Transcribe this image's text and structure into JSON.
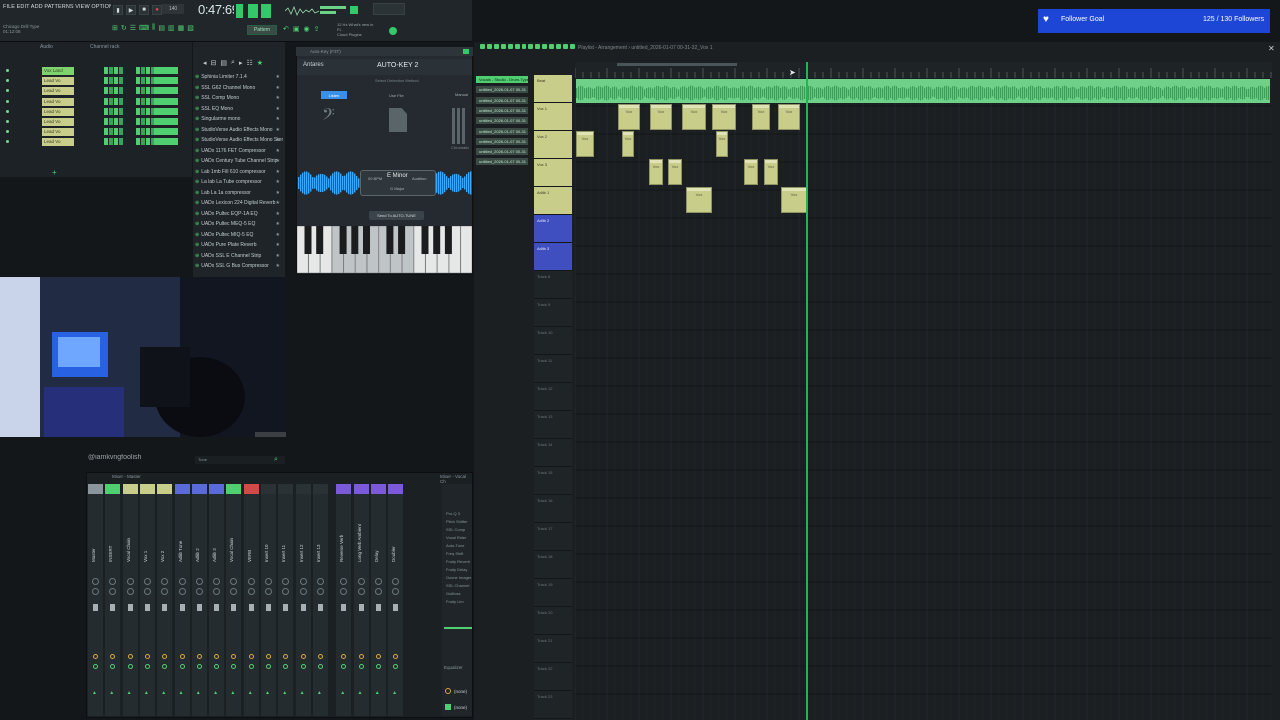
{
  "menu": {
    "items_text": "FILE EDIT ADD PATTERNS VIEW OPTIONS TOOLS HELP"
  },
  "song": {
    "line1": "Chicago Drill Type",
    "line2": "01:12:08"
  },
  "transport": {
    "tempo": "140",
    "time": "0:47:69",
    "pattern_button": "Pattern"
  },
  "cpu": {
    "line1": "12 Hz  What's new in FL",
    "line2": "Cloud Plugins"
  },
  "rack": {
    "header_left": "Audio",
    "header_right": "Channel rack",
    "rows": [
      {
        "name": "Vox Land"
      },
      {
        "name": "Lead Vo"
      },
      {
        "name": "Lead Vo"
      },
      {
        "name": "Lead Vo"
      },
      {
        "name": "Lead Vo"
      },
      {
        "name": "Lead Vo"
      },
      {
        "name": "Lead Vo"
      },
      {
        "name": "Lead Vo"
      }
    ]
  },
  "browser": {
    "items": [
      "Sphinia Limiter 7.1.4",
      "SSL G62 Channel Mono",
      "SSL Comp Mono",
      "SSL EQ Mono",
      "Singularme mono",
      "StudioVerse Audio Effects Mono",
      "StudioVerse Audio Effects Mono Stereo",
      "UADx 1176 FET Compressor",
      "UADx Century Tube Channel Strip",
      "Lab 1mb Fill 610 compressor",
      "La lab La Tube compressor",
      "Lab La 1a compressor",
      "UADx Lexicon 224 Digital Reverb",
      "UADx Pultec EQP-1A EQ",
      "UADx Pultec MEQ-5 EQ",
      "UADx Pultec MIQ-5 EQ",
      "UADx Pure Plate Reverb",
      "UADx SSL E Channel Strip",
      "UADx SSL G Bus Compressor"
    ]
  },
  "plugin": {
    "title": "Auto-Key (F3T)",
    "brand": "Antares",
    "logo": "AUTO-KEY 2",
    "subtitle": "Select Detection Method",
    "listen": "Listen",
    "file": "Use File",
    "manual": "Manual",
    "chromatic": "Chromatic",
    "detected_key": "E Minor",
    "tempo_small": "00 BPM",
    "alt": "Audition",
    "scale_small": "G Major",
    "send": "Send To AUTO-TUNE"
  },
  "stream": {
    "handle": "@iamkvngfoolish",
    "input_value": "Tune"
  },
  "mixer": {
    "header_left": "Mixer - Master",
    "header_right": "Mixer - Vocal Ch",
    "tracks": [
      {
        "name": "Master",
        "color": "#8a969b"
      },
      {
        "name": "INSERT",
        "color": "#4fcf70"
      },
      {
        "name": "Vocal Chain",
        "color": "#c8ce8a"
      },
      {
        "name": "Vox 1",
        "color": "#c8ce8a"
      },
      {
        "name": "Vox 2",
        "color": "#c8ce8a"
      },
      {
        "name": "Adlib Tune",
        "color": "#5a6ad8"
      },
      {
        "name": "Adlib 2",
        "color": "#5a6ad8"
      },
      {
        "name": "Adlib 3",
        "color": "#5a6ad8"
      },
      {
        "name": "Vocal Chain",
        "color": "#4fcf70"
      },
      {
        "name": "VERB",
        "color": "#d04a4a"
      },
      {
        "name": "Insert 10",
        "color": "#2b3236"
      },
      {
        "name": "Insert 11",
        "color": "#2b3236"
      },
      {
        "name": "Insert 12",
        "color": "#2b3236"
      },
      {
        "name": "Insert 13",
        "color": "#2b3236"
      },
      {
        "name": "Reverse Verb",
        "color": "#7a5ad8"
      },
      {
        "name": "Long Verb Ambient",
        "color": "#7a5ad8"
      },
      {
        "name": "Delay",
        "color": "#7a5ad8"
      },
      {
        "name": "Doubler",
        "color": "#7a5ad8"
      }
    ],
    "inserts": [
      "Pro-Q 3",
      "Pitch Shifter",
      "SSL Comp",
      "Vocal Rider",
      "Auto-Tune",
      "Freq Shift",
      "Fruity Reverb",
      "Fruity Delay",
      "Ozone Imager",
      "SSL Channel",
      "Gullfoss",
      "Fruity Lim"
    ],
    "eq_label": "Equalizer",
    "none1": "(none)",
    "none2": "(none)"
  },
  "playlist": {
    "title": "Playlist - Arrangement › untitled_2026-01-07 00-31-32_Vox 1",
    "patterns": [
      "Vocals - Studio - Drum-Type-Beat",
      "untitled_2026-01-07 00-31",
      "untitled_2026-01-07 00-31",
      "untitled_2026-01-07 00-31",
      "untitled_2026-01-07 00-31",
      "untitled_2026-01-07 00-31",
      "untitled_2026-01-07 00-31",
      "untitled_2026-01-07 00-31",
      "untitled_2026-01-07 00-31"
    ],
    "tracks": [
      {
        "name": "Beat",
        "kind": "y"
      },
      {
        "name": "Vox 1",
        "kind": "y"
      },
      {
        "name": "Vox 2",
        "kind": "y"
      },
      {
        "name": "Vox 3",
        "kind": "y"
      },
      {
        "name": "Adlib 1",
        "kind": "y"
      },
      {
        "name": "Adlib 2",
        "kind": "b"
      },
      {
        "name": "Adlib 3",
        "kind": "b"
      },
      {
        "name": "Track 8",
        "kind": "e"
      },
      {
        "name": "Track 9",
        "kind": "e"
      },
      {
        "name": "Track 10",
        "kind": "e"
      },
      {
        "name": "Track 11",
        "kind": "e"
      },
      {
        "name": "Track 12",
        "kind": "e"
      },
      {
        "name": "Track 13",
        "kind": "e"
      },
      {
        "name": "Track 14",
        "kind": "e"
      },
      {
        "name": "Track 15",
        "kind": "e"
      },
      {
        "name": "Track 16",
        "kind": "e"
      },
      {
        "name": "Track 17",
        "kind": "e"
      },
      {
        "name": "Track 18",
        "kind": "e"
      },
      {
        "name": "Track 19",
        "kind": "e"
      },
      {
        "name": "Track 20",
        "kind": "e"
      },
      {
        "name": "Track 21",
        "kind": "e"
      },
      {
        "name": "Track 22",
        "kind": "e"
      },
      {
        "name": "Track 23",
        "kind": "e"
      }
    ],
    "clip_label": "Vox"
  },
  "follower_goal": {
    "label": "Follower Goal",
    "count": "125 / 130 Followers"
  },
  "colors": {
    "accent": "#35c86a",
    "clip": "#c8ce8a",
    "blue_track": "#3f4fc0",
    "goal": "#1d46d6"
  }
}
